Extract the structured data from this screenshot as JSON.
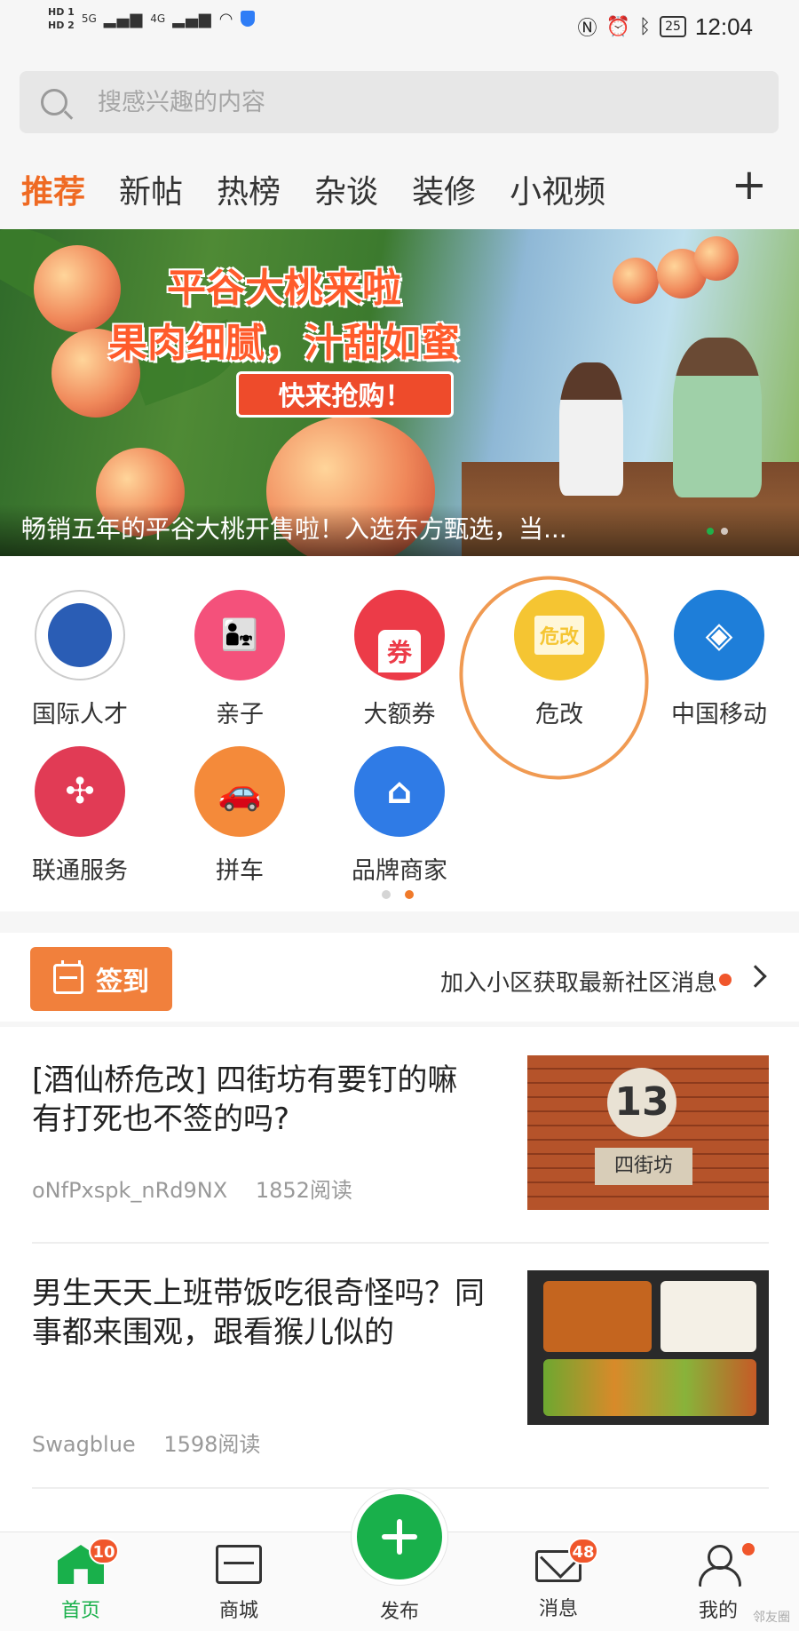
{
  "status_bar": {
    "hd1": "HD 1",
    "hd2": "HD 2",
    "net1": "5G",
    "net2": "4G",
    "battery": "25",
    "time": "12:04"
  },
  "search": {
    "placeholder": "搜感兴趣的内容"
  },
  "tabs": [
    {
      "label": "推荐",
      "active": true
    },
    {
      "label": "新帖"
    },
    {
      "label": "热榜"
    },
    {
      "label": "杂谈"
    },
    {
      "label": "装修"
    },
    {
      "label": "小视频"
    }
  ],
  "tab_add": "+",
  "banner": {
    "line1": "平谷大桃来啦",
    "line2": "果肉细腻，汁甜如蜜",
    "cta": "快来抢购！",
    "caption": "畅销五年的平谷大桃开售啦！入选东方甄选，当..."
  },
  "grid": [
    {
      "label": "国际人才",
      "icon": "talent-icon",
      "color": "#ffffff"
    },
    {
      "label": "亲子",
      "icon": "parent-child-icon",
      "color": "#f4517b"
    },
    {
      "label": "大额券",
      "icon": "coupon-icon",
      "color": "#ec3b48",
      "glyph": "券"
    },
    {
      "label": "危改",
      "icon": "renovation-icon",
      "color": "#f5c532",
      "glyph": "危改"
    },
    {
      "label": "中国移动",
      "icon": "china-mobile-icon",
      "color": "#1e7ed9"
    },
    {
      "label": "联通服务",
      "icon": "unicom-icon",
      "color": "#e13b55"
    },
    {
      "label": "拼车",
      "icon": "car-icon",
      "color": "#f48a3a"
    },
    {
      "label": "品牌商家",
      "icon": "store-icon",
      "color": "#2f7be6"
    }
  ],
  "checkin": {
    "label": "签到",
    "join_text": "加入小区获取最新社区消息"
  },
  "posts": [
    {
      "title": "[酒仙桥危改] 四街坊有要钉的嘛 有打死也不签的吗?",
      "author": "oNfPxspk_nRd9NX",
      "reads": "1852阅读",
      "thumb_sign": "13",
      "thumb_plaque": "四街坊"
    },
    {
      "title": "男生天天上班带饭吃很奇怪吗？同事都来围观，跟看猴儿似的",
      "author": "Swagblue",
      "reads": "1598阅读"
    }
  ],
  "bottom_nav": {
    "home": {
      "label": "首页",
      "badge": "10"
    },
    "mall": {
      "label": "商城"
    },
    "publish": {
      "label": "发布"
    },
    "messages": {
      "label": "消息",
      "badge": "48"
    },
    "me": {
      "label": "我的"
    }
  },
  "watermark": "邻友圈",
  "colors": {
    "accent": "#ef6a23",
    "primary_green": "#19b04b",
    "badge_red": "#f0562b"
  }
}
